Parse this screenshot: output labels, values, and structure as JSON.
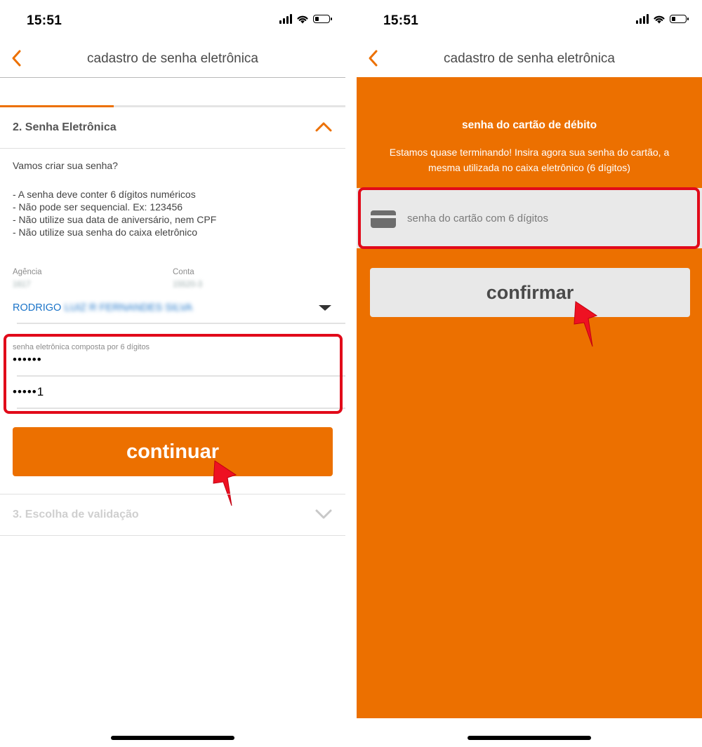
{
  "left_screen": {
    "status": {
      "time": "15:51"
    },
    "nav": {
      "title": "cadastro de senha eletrônica"
    },
    "progress": 0.33,
    "section2": {
      "label": "2. Senha Eletrônica"
    },
    "intro": "Vamos criar sua senha?",
    "rules": [
      "- A senha deve conter 6 dígitos numéricos",
      "- Não pode ser sequencial. Ex: 123456",
      "- Não utilize sua data de aniversário, nem CPF",
      "- Não utilize sua senha do caixa eletrônico"
    ],
    "agencia": {
      "label": "Agência",
      "value": "1617"
    },
    "conta": {
      "label": "Conta",
      "value": "15520-3"
    },
    "account_holder": {
      "first": "RODRIGO",
      "rest": "LUIZ R FERNANDES SILVA"
    },
    "password_field": {
      "label": "senha eletrônica composta por 6 dígitos",
      "value": "••••••",
      "confirm_value": "•••••1"
    },
    "continue_button": "continuar",
    "section3": {
      "label": "3. Escolha de validação"
    }
  },
  "right_screen": {
    "status": {
      "time": "15:51"
    },
    "nav": {
      "title": "cadastro de senha eletrônica"
    },
    "heading": "senha do cartão de débito",
    "description": "Estamos quase terminando! Insira agora sua senha do cartão, a mesma utilizada no caixa eletrônico (6 dígitos)",
    "card_field": {
      "placeholder": "senha do cartão com 6 dígitos",
      "icon": "card-icon"
    },
    "confirm_button": "confirmar"
  },
  "colors": {
    "accent": "#ec7000",
    "annotation_red": "#e10a1a",
    "link_blue": "#1a73c8"
  }
}
